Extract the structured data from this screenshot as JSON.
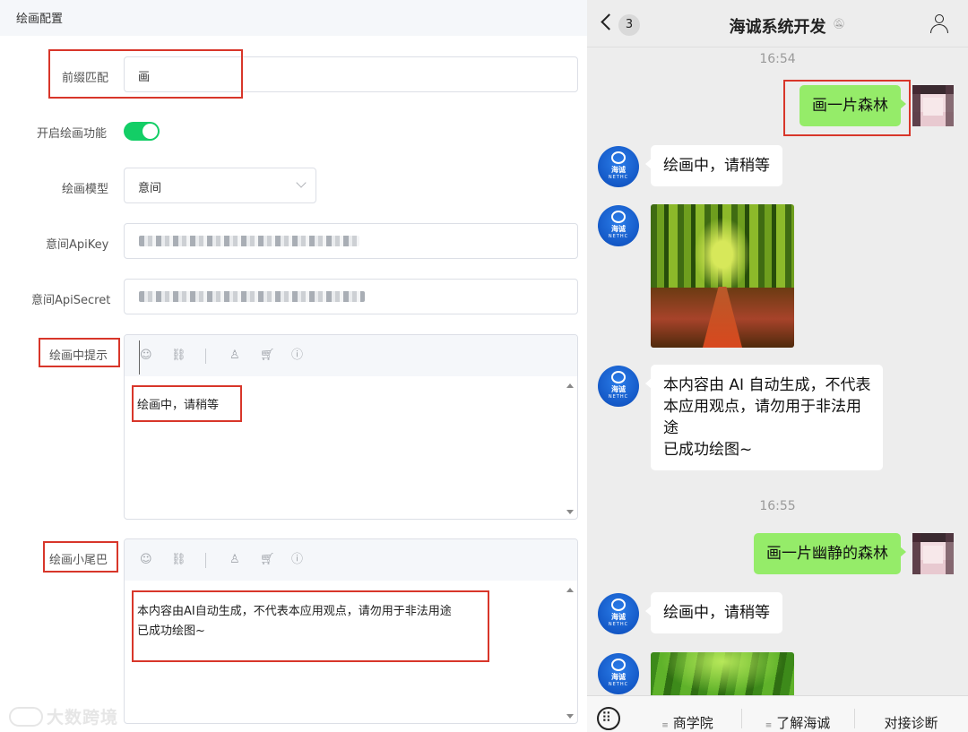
{
  "left_panel": {
    "header_title": "绘画配置",
    "prefix": {
      "label": "前缀匹配",
      "value": "画"
    },
    "enable_draw": {
      "label": "开启绘画功能",
      "on": true
    },
    "model": {
      "label": "绘画模型",
      "value": "意间"
    },
    "api_key": {
      "label": "意间ApiKey"
    },
    "api_secret": {
      "label": "意间ApiSecret"
    },
    "drawing_tip": {
      "label": "绘画中提示",
      "text": "绘画中，请稍等"
    },
    "tail": {
      "label": "绘画小尾巴",
      "text": "本内容由AI自动生成，不代表本应用观点，请勿用于非法用途\n已成功绘图~"
    },
    "toolbar_icons": [
      "smile-icon",
      "link-icon",
      "user-icon",
      "cart-icon",
      "info-icon"
    ],
    "watermark": "大数跨境",
    "accent_color": "#13ce66",
    "highlight_color": "#d8362a"
  },
  "chat": {
    "back_icon": "chevron-left-icon",
    "unread_count": "3",
    "title": "海诚系统开发",
    "mute_icon": "bell-off-icon",
    "header_right_icon": "user-icon",
    "bot_name_text": "海诚",
    "bot_sub_text": "NETHC",
    "messages": [
      {
        "time": "16:54"
      },
      {
        "from": "me",
        "text": "画一片森林"
      },
      {
        "from": "bot",
        "text": "绘画中，请稍等"
      },
      {
        "from": "bot",
        "image": "forest-image"
      },
      {
        "from": "bot",
        "text": "本内容由 AI 自动生成，不代表\n本应用观点，请勿用于非法用\n途\n已成功绘图~"
      },
      {
        "time": "16:55"
      },
      {
        "from": "me",
        "text": "画一片幽静的森林"
      },
      {
        "from": "bot",
        "text": "绘画中，请稍等"
      },
      {
        "from": "bot",
        "image": "forest-image"
      }
    ],
    "bottom_menu": [
      "商学院",
      "了解海诚",
      "对接诊断"
    ],
    "bubble_me_color": "#95ec69",
    "bubble_other_color": "#ffffff"
  }
}
